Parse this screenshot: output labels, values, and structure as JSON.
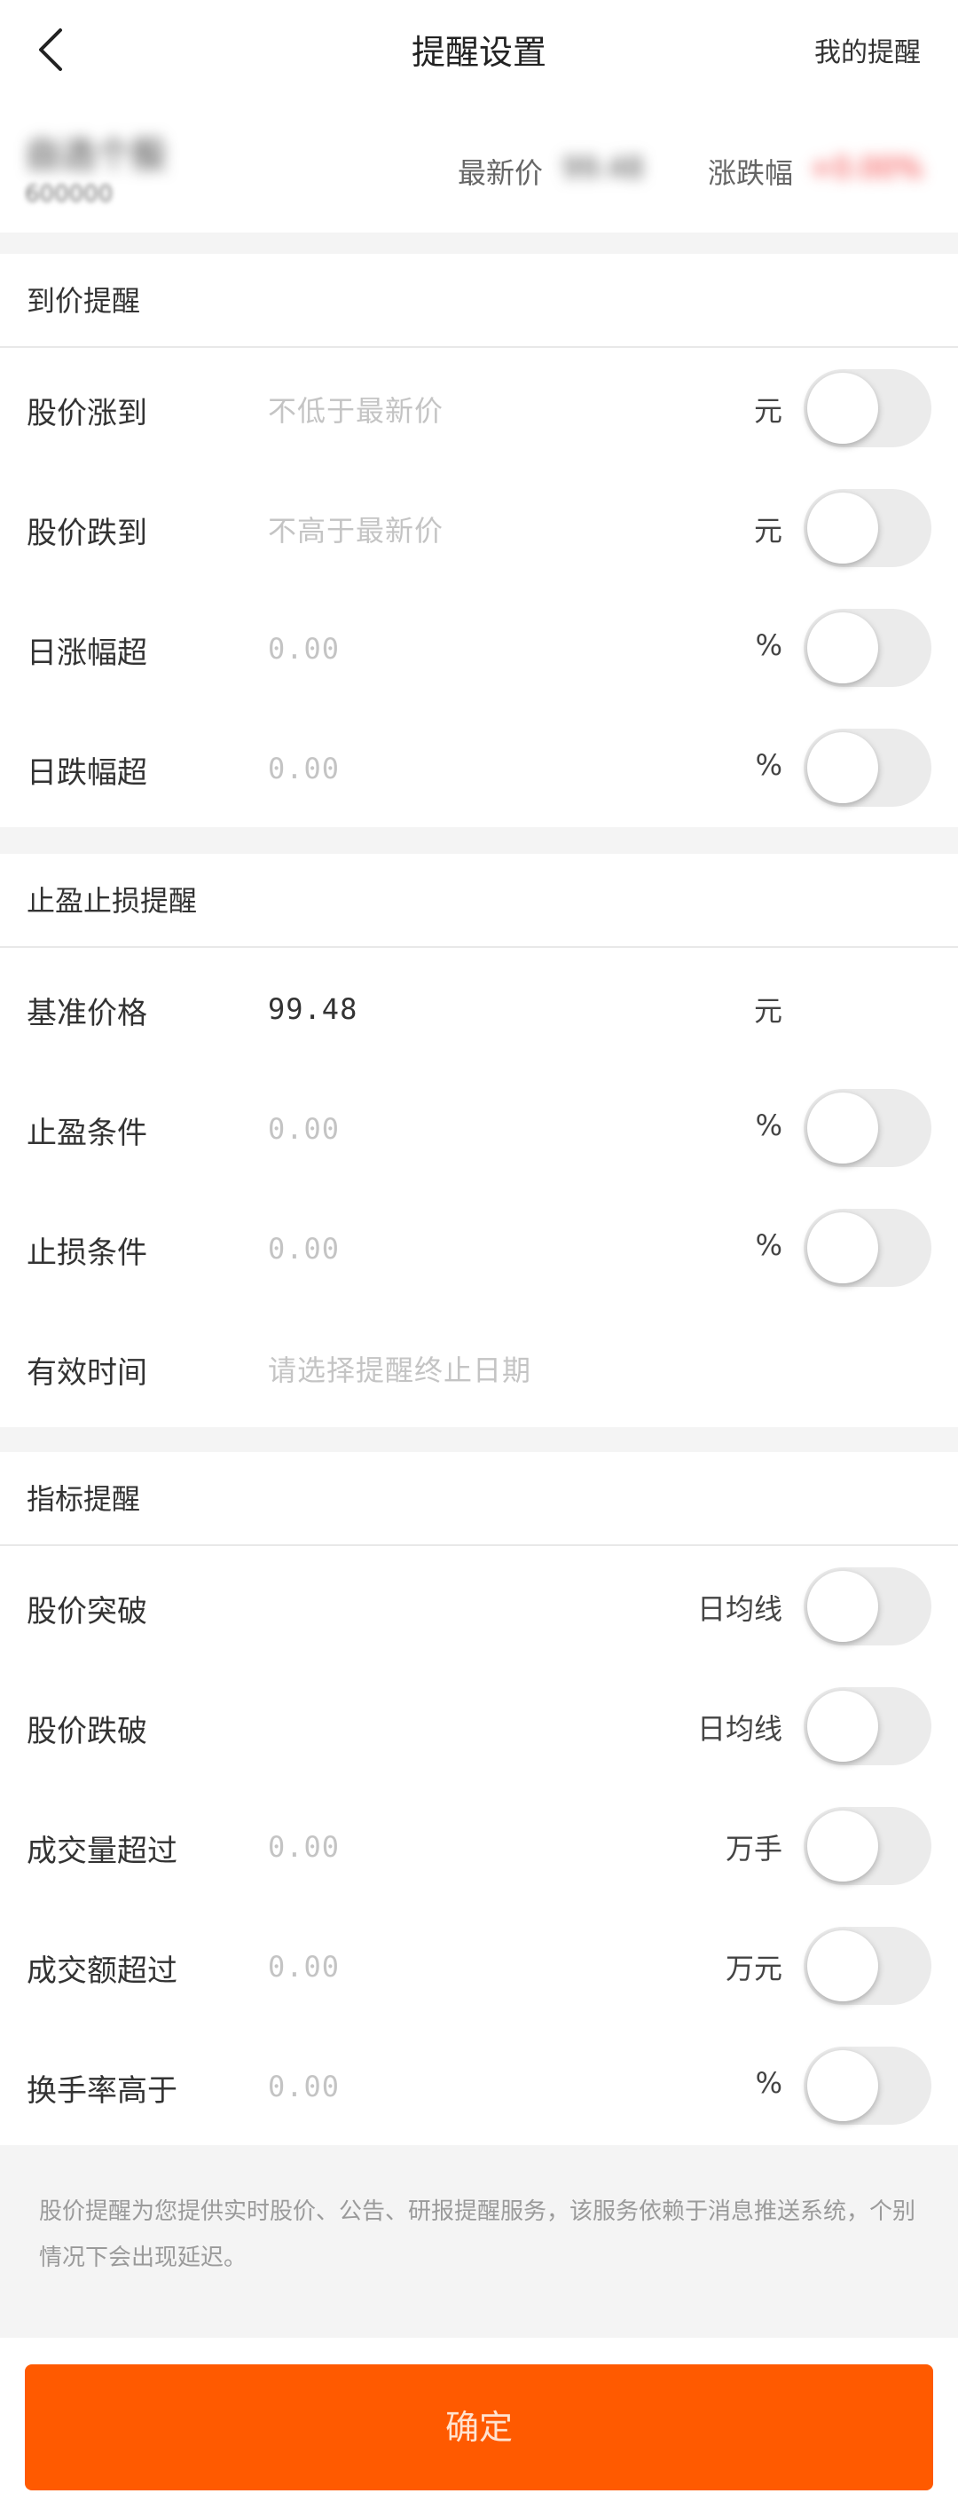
{
  "header": {
    "title": "提醒设置",
    "my_reminders": "我的提醒"
  },
  "stock": {
    "name": "自选个股",
    "code": "600000",
    "price_label": "最新价",
    "price_value": "99.48",
    "change_label": "涨跌幅",
    "change_value": "+0.00%"
  },
  "price_section": {
    "title": "到价提醒",
    "rows": [
      {
        "label": "股价涨到",
        "placeholder": "不低于最新价",
        "unit": "元"
      },
      {
        "label": "股价跌到",
        "placeholder": "不高于最新价",
        "unit": "元"
      },
      {
        "label": "日涨幅超",
        "placeholder": "0.00",
        "unit": "%"
      },
      {
        "label": "日跌幅超",
        "placeholder": "0.00",
        "unit": "%"
      }
    ]
  },
  "stop_section": {
    "title": "止盈止损提醒",
    "rows": [
      {
        "label": "基准价格",
        "value": "99.48",
        "unit": "元"
      },
      {
        "label": "止盈条件",
        "placeholder": "0.00",
        "unit": "%"
      },
      {
        "label": "止损条件",
        "placeholder": "0.00",
        "unit": "%"
      },
      {
        "label": "有效时间",
        "placeholder": "请选择提醒终止日期"
      }
    ]
  },
  "indicator_section": {
    "title": "指标提醒",
    "rows": [
      {
        "label": "股价突破",
        "unit": "日均线"
      },
      {
        "label": "股价跌破",
        "unit": "日均线"
      },
      {
        "label": "成交量超过",
        "placeholder": "0.00",
        "unit": "万手"
      },
      {
        "label": "成交额超过",
        "placeholder": "0.00",
        "unit": "万元"
      },
      {
        "label": "换手率高于",
        "placeholder": "0.00",
        "unit": "%"
      }
    ]
  },
  "notice": "股价提醒为您提供实时股价、公告、研报提醒服务，该服务依赖于消息推送系统，个别情况下会出现延迟。",
  "confirm_label": "确定",
  "colors": {
    "accent": "#ff5a00",
    "toggle_off": "#ebebeb",
    "negative_change": "#f23030"
  }
}
